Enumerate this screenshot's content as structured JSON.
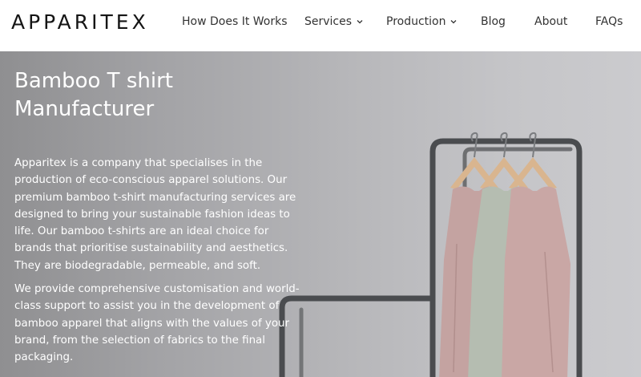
{
  "brand": {
    "logo_text": "APPARITEX"
  },
  "nav": {
    "items": [
      {
        "label": "How Does It Works",
        "dropdown": false
      },
      {
        "label": "Services",
        "dropdown": true
      },
      {
        "label": "Production",
        "dropdown": true
      },
      {
        "label": "Blog",
        "dropdown": false
      },
      {
        "label": "About",
        "dropdown": false
      },
      {
        "label": "FAQs",
        "dropdown": false
      }
    ]
  },
  "hero": {
    "title": "Bamboo T shirt Manufacturer",
    "paragraph_1": "Apparitex is a company that specialises in the production of eco-conscious apparel solutions. Our premium bamboo t-shirt manufacturing services are designed to bring your sustainable fashion ideas to life. Our bamboo t-shirts are an ideal choice for brands that prioritise sustainability and aesthetics. They are biodegradable, permeable, and soft.",
    "paragraph_2": "We provide comprehensive customisation and world-class support to assist you in the development of bamboo apparel that aligns with the values of your brand, from the selection of fabrics to the final packaging."
  },
  "colors": {
    "text_dark": "#151515",
    "nav_text": "#333333",
    "hero_text": "#ffffff",
    "hero_bg": "#b4b4b7",
    "shirt_pink": "#c4a3a1",
    "shirt_green": "#b5bdb1",
    "rack_metal": "#4a4c4f"
  }
}
